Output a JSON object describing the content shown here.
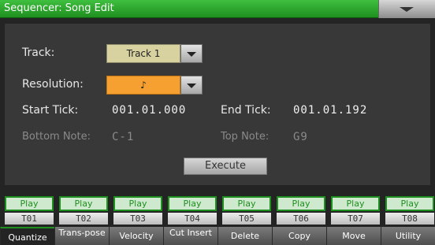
{
  "title": "Sequencer: Song Edit",
  "menu_icon": "menu-triangle-icon",
  "track": {
    "label": "Track:",
    "value": "Track 1"
  },
  "resolution": {
    "label": "Resolution:",
    "value": "♪",
    "highlight_color": "#f6a032"
  },
  "start_tick": {
    "label": "Start Tick:",
    "value": "001.01.000"
  },
  "end_tick": {
    "label": "End Tick:",
    "value": "001.01.192"
  },
  "bottom_note": {
    "label": "Bottom Note:",
    "value": "C-1"
  },
  "top_note": {
    "label": "Top Note:",
    "value": "G9"
  },
  "execute_label": "Execute",
  "tracks": [
    {
      "play": "Play",
      "label": "T01"
    },
    {
      "play": "Play",
      "label": "T02"
    },
    {
      "play": "Play",
      "label": "T03"
    },
    {
      "play": "Play",
      "label": "T04"
    },
    {
      "play": "Play",
      "label": "T05"
    },
    {
      "play": "Play",
      "label": "T06"
    },
    {
      "play": "Play",
      "label": "T07"
    },
    {
      "play": "Play",
      "label": "T08"
    }
  ],
  "tabs": [
    {
      "label": "Quantize",
      "active": true
    },
    {
      "label": "Trans-pose"
    },
    {
      "label": "Velocity"
    },
    {
      "label": "Cut Insert"
    },
    {
      "label": "Delete"
    },
    {
      "label": "Copy"
    },
    {
      "label": "Move"
    },
    {
      "label": "Utility"
    }
  ],
  "colors": {
    "accent": "#1f8f1f",
    "track_field": "#d8d2a0"
  }
}
